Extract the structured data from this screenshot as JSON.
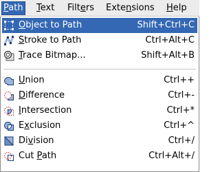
{
  "menubar": {
    "items": [
      {
        "mnemonic": "P",
        "rest": "ath"
      },
      {
        "mnemonic": "T",
        "rest": "ext"
      },
      {
        "pre": "Filt",
        "mnemonic": "e",
        "rest": "rs"
      },
      {
        "pre": "Exte",
        "mnemonic": "n",
        "rest": "sions"
      },
      {
        "mnemonic": "H",
        "rest": "elp"
      }
    ]
  },
  "path_menu": {
    "items": [
      {
        "mnemonic": "O",
        "rest": "bject to Path",
        "accel": "Shift+Ctrl+C",
        "icon": "object-to-path-icon"
      },
      {
        "mnemonic": "S",
        "rest": "troke to Path",
        "accel": "Ctrl+Alt+C",
        "icon": "stroke-to-path-icon"
      },
      {
        "mnemonic": "T",
        "rest": "race Bitmap...",
        "accel": "Shift+Alt+B",
        "icon": "trace-bitmap-icon"
      },
      {
        "mnemonic": "U",
        "rest": "nion",
        "accel": "Ctrl++",
        "icon": "union-icon"
      },
      {
        "mnemonic": "D",
        "rest": "ifference",
        "accel": "Ctrl+-",
        "icon": "difference-icon"
      },
      {
        "mnemonic": "I",
        "rest": "ntersection",
        "accel": "Ctrl+*",
        "icon": "intersection-icon"
      },
      {
        "pre": "E",
        "mnemonic": "x",
        "rest": "clusion",
        "accel": "Ctrl+^",
        "icon": "exclusion-icon"
      },
      {
        "pre": "Di",
        "mnemonic": "v",
        "rest": "ision",
        "accel": "Ctrl+/",
        "icon": "division-icon"
      },
      {
        "pre": "Cut ",
        "mnemonic": "P",
        "rest": "ath",
        "accel": "Ctrl+Alt+/",
        "icon": "cut-path-icon"
      }
    ]
  },
  "colors": {
    "highlight": "#3468b4",
    "menubar_bg": "#ececec",
    "icon_fill": "#9cb4d8",
    "icon_stroke": "#1a3c78",
    "icon_dash": "#c01818"
  }
}
